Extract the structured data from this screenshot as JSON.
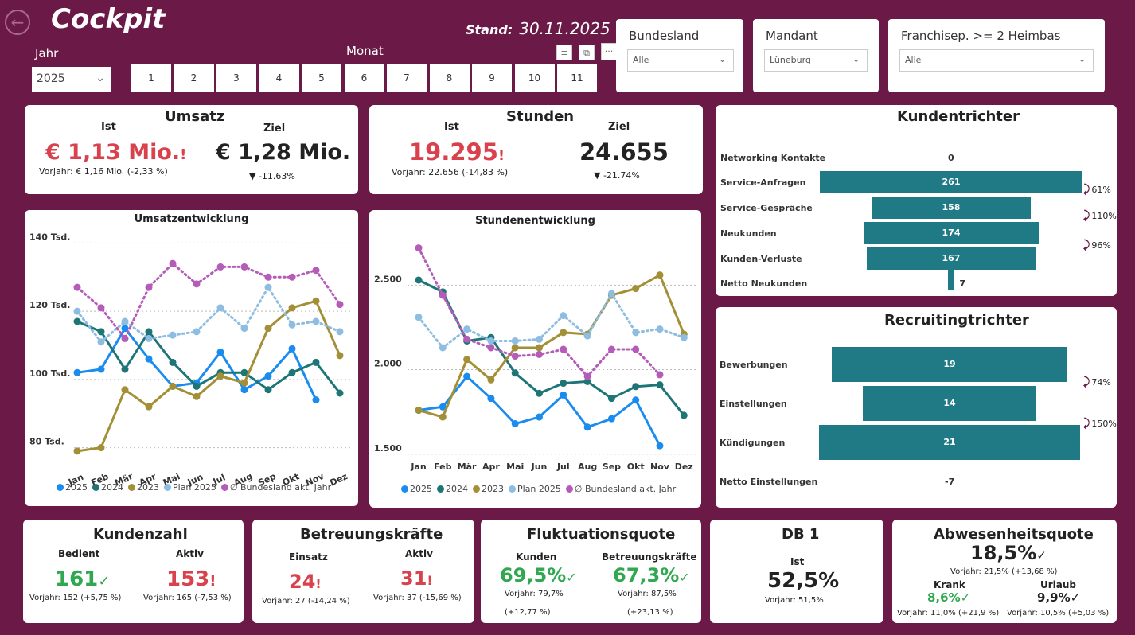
{
  "header": {
    "title": "Cockpit",
    "stand_label": "Stand:",
    "stand_date": "30.11.2025",
    "jahr_label": "Jahr",
    "jahr_value": "2025",
    "monat_label": "Monat",
    "months": [
      "1",
      "2",
      "3",
      "4",
      "5",
      "6",
      "7",
      "8",
      "9",
      "10",
      "11"
    ]
  },
  "filters": {
    "bundesland": {
      "label": "Bundesland",
      "value": "Alle"
    },
    "mandant": {
      "label": "Mandant",
      "value": "Lüneburg"
    },
    "franchise": {
      "label": "Franchisep. >= 2 Heimbas",
      "value": "Alle"
    }
  },
  "umsatz": {
    "title": "Umsatz",
    "ist_label": "Ist",
    "ziel_label": "Ziel",
    "ist_value": "€ 1,13 Mio.",
    "ist_flag": "!",
    "ziel_value": "€ 1,28 Mio.",
    "vorjahr": "Vorjahr: € 1,16 Mio. (-2,33 %)",
    "delta": "▼ -11.63%"
  },
  "stunden": {
    "title": "Stunden",
    "ist_label": "Ist",
    "ziel_label": "Ziel",
    "ist_value": "19.295",
    "ist_flag": "!",
    "ziel_value": "24.655",
    "vorjahr": "Vorjahr: 22.656 (-14,83 %)",
    "delta": "▼ -21.74%"
  },
  "kundentrichter": {
    "title": "Kundentrichter",
    "rows": [
      {
        "label": "Networking Kontakte",
        "value": "0"
      },
      {
        "label": "Service-Anfragen",
        "value": "261"
      },
      {
        "label": "Service-Gespräche",
        "value": "158"
      },
      {
        "label": "Neukunden",
        "value": "174"
      },
      {
        "label": "Kunden-Verluste",
        "value": "167"
      },
      {
        "label": "Netto Neukunden",
        "value": "7"
      }
    ],
    "conversions": [
      "61%",
      "110%",
      "96%"
    ]
  },
  "recruitingtrichter": {
    "title": "Recruitingtrichter",
    "rows": [
      {
        "label": "Bewerbungen",
        "value": "19"
      },
      {
        "label": "Einstellungen",
        "value": "14"
      },
      {
        "label": "Kündigungen",
        "value": "21"
      },
      {
        "label": "Netto Einstellungen",
        "value": "-7"
      }
    ],
    "conversions": [
      "74%",
      "150%"
    ]
  },
  "legend": {
    "s2025": "2025",
    "s2024": "2024",
    "s2023": "2023",
    "plan": "Plan 2025",
    "bl": "∅ Bundesland akt. Jahr"
  },
  "colors": {
    "s2025": "#1a8cf0",
    "s2024": "#1d7576",
    "s2023": "#a38f35",
    "plan": "#8dbde0",
    "bl": "#b45cb8",
    "teal": "#1f7a86",
    "bg": "#6b1a48",
    "red": "#d9414d",
    "green": "#2fa84f"
  },
  "chart_data": [
    {
      "type": "line",
      "title": "Umsatzentwicklung",
      "categories": [
        "Jan",
        "Feb",
        "Mär",
        "Apr",
        "Mai",
        "Jun",
        "Jul",
        "Aug",
        "Sep",
        "Okt",
        "Nov",
        "Dez"
      ],
      "y_ticks": [
        "140 Tsd.",
        "120 Tsd.",
        "100 Tsd.",
        "80 Tsd."
      ],
      "ylim": [
        75,
        145
      ],
      "series": [
        {
          "name": "2025",
          "values": [
            102,
            103,
            115,
            106,
            98,
            99,
            108,
            97,
            101,
            109,
            94,
            null
          ]
        },
        {
          "name": "2024",
          "values": [
            117,
            114,
            103,
            114,
            105,
            98,
            102,
            102,
            97,
            102,
            105,
            96
          ]
        },
        {
          "name": "2023",
          "values": [
            79,
            80,
            97,
            92,
            98,
            95,
            101,
            99,
            115,
            121,
            123,
            107
          ]
        },
        {
          "name": "Plan 2025",
          "values": [
            120,
            111,
            117,
            112,
            113,
            114,
            121,
            115,
            127,
            116,
            117,
            114
          ]
        },
        {
          "name": "∅ Bundesland akt. Jahr",
          "values": [
            127,
            121,
            112,
            127,
            134,
            128,
            133,
            133,
            130,
            130,
            132,
            122
          ]
        }
      ]
    },
    {
      "type": "line",
      "title": "Stundenentwicklung",
      "categories": [
        "Jan",
        "Feb",
        "Mär",
        "Apr",
        "Mai",
        "Jun",
        "Jul",
        "Aug",
        "Sep",
        "Okt",
        "Nov",
        "Dez"
      ],
      "y_ticks": [
        "2.500",
        "2.000",
        "1.500"
      ],
      "ylim": [
        1400,
        2850
      ],
      "series": [
        {
          "name": "2025",
          "values": [
            1760,
            1780,
            1960,
            1830,
            1680,
            1720,
            1850,
            1660,
            1710,
            1820,
            1550,
            null
          ]
        },
        {
          "name": "2024",
          "values": [
            2530,
            2460,
            2170,
            2190,
            1980,
            1860,
            1920,
            1930,
            1830,
            1900,
            1910,
            1730
          ]
        },
        {
          "name": "2023",
          "values": [
            1760,
            1720,
            2060,
            1940,
            2130,
            2130,
            2220,
            2210,
            2440,
            2480,
            2560,
            2210
          ]
        },
        {
          "name": "Plan 2025",
          "values": [
            2310,
            2130,
            2240,
            2170,
            2170,
            2180,
            2320,
            2200,
            2450,
            2220,
            2240,
            2190
          ]
        },
        {
          "name": "∅ Bundesland akt. Jahr",
          "values": [
            2720,
            2440,
            2180,
            2130,
            2080,
            2090,
            2120,
            1960,
            2120,
            2120,
            1970,
            null
          ]
        }
      ]
    }
  ],
  "kundenzahl": {
    "title": "Kundenzahl",
    "bedient_label": "Bedient",
    "aktiv_label": "Aktiv",
    "bedient_value": "161",
    "bedient_flag": "✓",
    "aktiv_value": "153",
    "aktiv_flag": "!",
    "bedient_vj": "Vorjahr: 152 (+5,75 %)",
    "aktiv_vj": "Vorjahr: 165 (-7,53 %)"
  },
  "betreuung": {
    "title": "Betreuungskräfte",
    "einsatz_label": "Einsatz",
    "aktiv_label": "Aktiv",
    "einsatz_value": "24",
    "einsatz_flag": "!",
    "aktiv_value": "31",
    "aktiv_flag": "!",
    "einsatz_vj": "Vorjahr: 27 (-14,24 %)",
    "aktiv_vj": "Vorjahr: 37 (-15,69 %)"
  },
  "fluktuation": {
    "title": "Fluktuationsquote",
    "kunden_label": "Kunden",
    "bk_label": "Betreuungskräfte",
    "kunden_value": "69,5%",
    "kunden_flag": "✓",
    "bk_value": "67,3%",
    "bk_flag": "✓",
    "kunden_vj": "Vorjahr: 79,7%",
    "kunden_vj2": "(+12,77 %)",
    "bk_vj": "Vorjahr: 87,5%",
    "bk_vj2": "(+23,13 %)"
  },
  "db1": {
    "title": "DB 1",
    "ist_label": "Ist",
    "value": "52,5%",
    "vorjahr": "Vorjahr: 51,5%"
  },
  "abwesenheit": {
    "title": "Abwesenheitsquote",
    "value": "18,5%",
    "flag": "✓",
    "vorjahr": "Vorjahr: 21,5% (+13,68 %)",
    "krank_label": "Krank",
    "krank_value": "8,6%",
    "krank_flag": "✓",
    "urlaub_label": "Urlaub",
    "urlaub_value": "9,9%",
    "urlaub_flag": "✓",
    "krank_vj": "Vorjahr: 11,0% (+21,9 %)",
    "urlaub_vj": "Vorjahr: 10,5% (+5,03 %)"
  }
}
